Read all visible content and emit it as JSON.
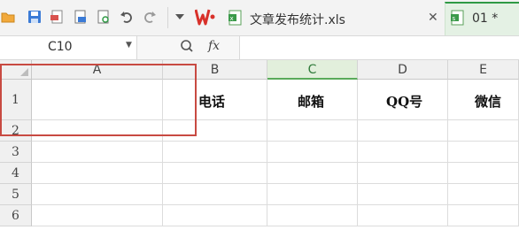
{
  "toolbar": {
    "icons": [
      "folder-icon",
      "save-icon",
      "export-pdf-icon",
      "print-icon",
      "print-preview-icon",
      "undo-icon",
      "redo-icon",
      "more-dropdown-icon"
    ],
    "wps_logo": "W"
  },
  "tabs": [
    {
      "label": "文章发布统计.xls",
      "icon": "excel-file-icon",
      "close": "✕"
    },
    {
      "label": "01 *",
      "icon": "sheet-file-icon",
      "active": true
    }
  ],
  "formula_bar": {
    "name_box": "C10",
    "fx": "fx",
    "formula": ""
  },
  "columns": [
    "A",
    "B",
    "C",
    "D",
    "E"
  ],
  "active_column": "C",
  "rows": [
    "1",
    "2",
    "3",
    "4",
    "5",
    "6"
  ],
  "row1_headers": {
    "B": "电话",
    "C": "邮箱",
    "D": "QQ号",
    "E": "微信"
  },
  "colors": {
    "accent_green": "#2f9a45",
    "selection_red": "#c84a42"
  }
}
